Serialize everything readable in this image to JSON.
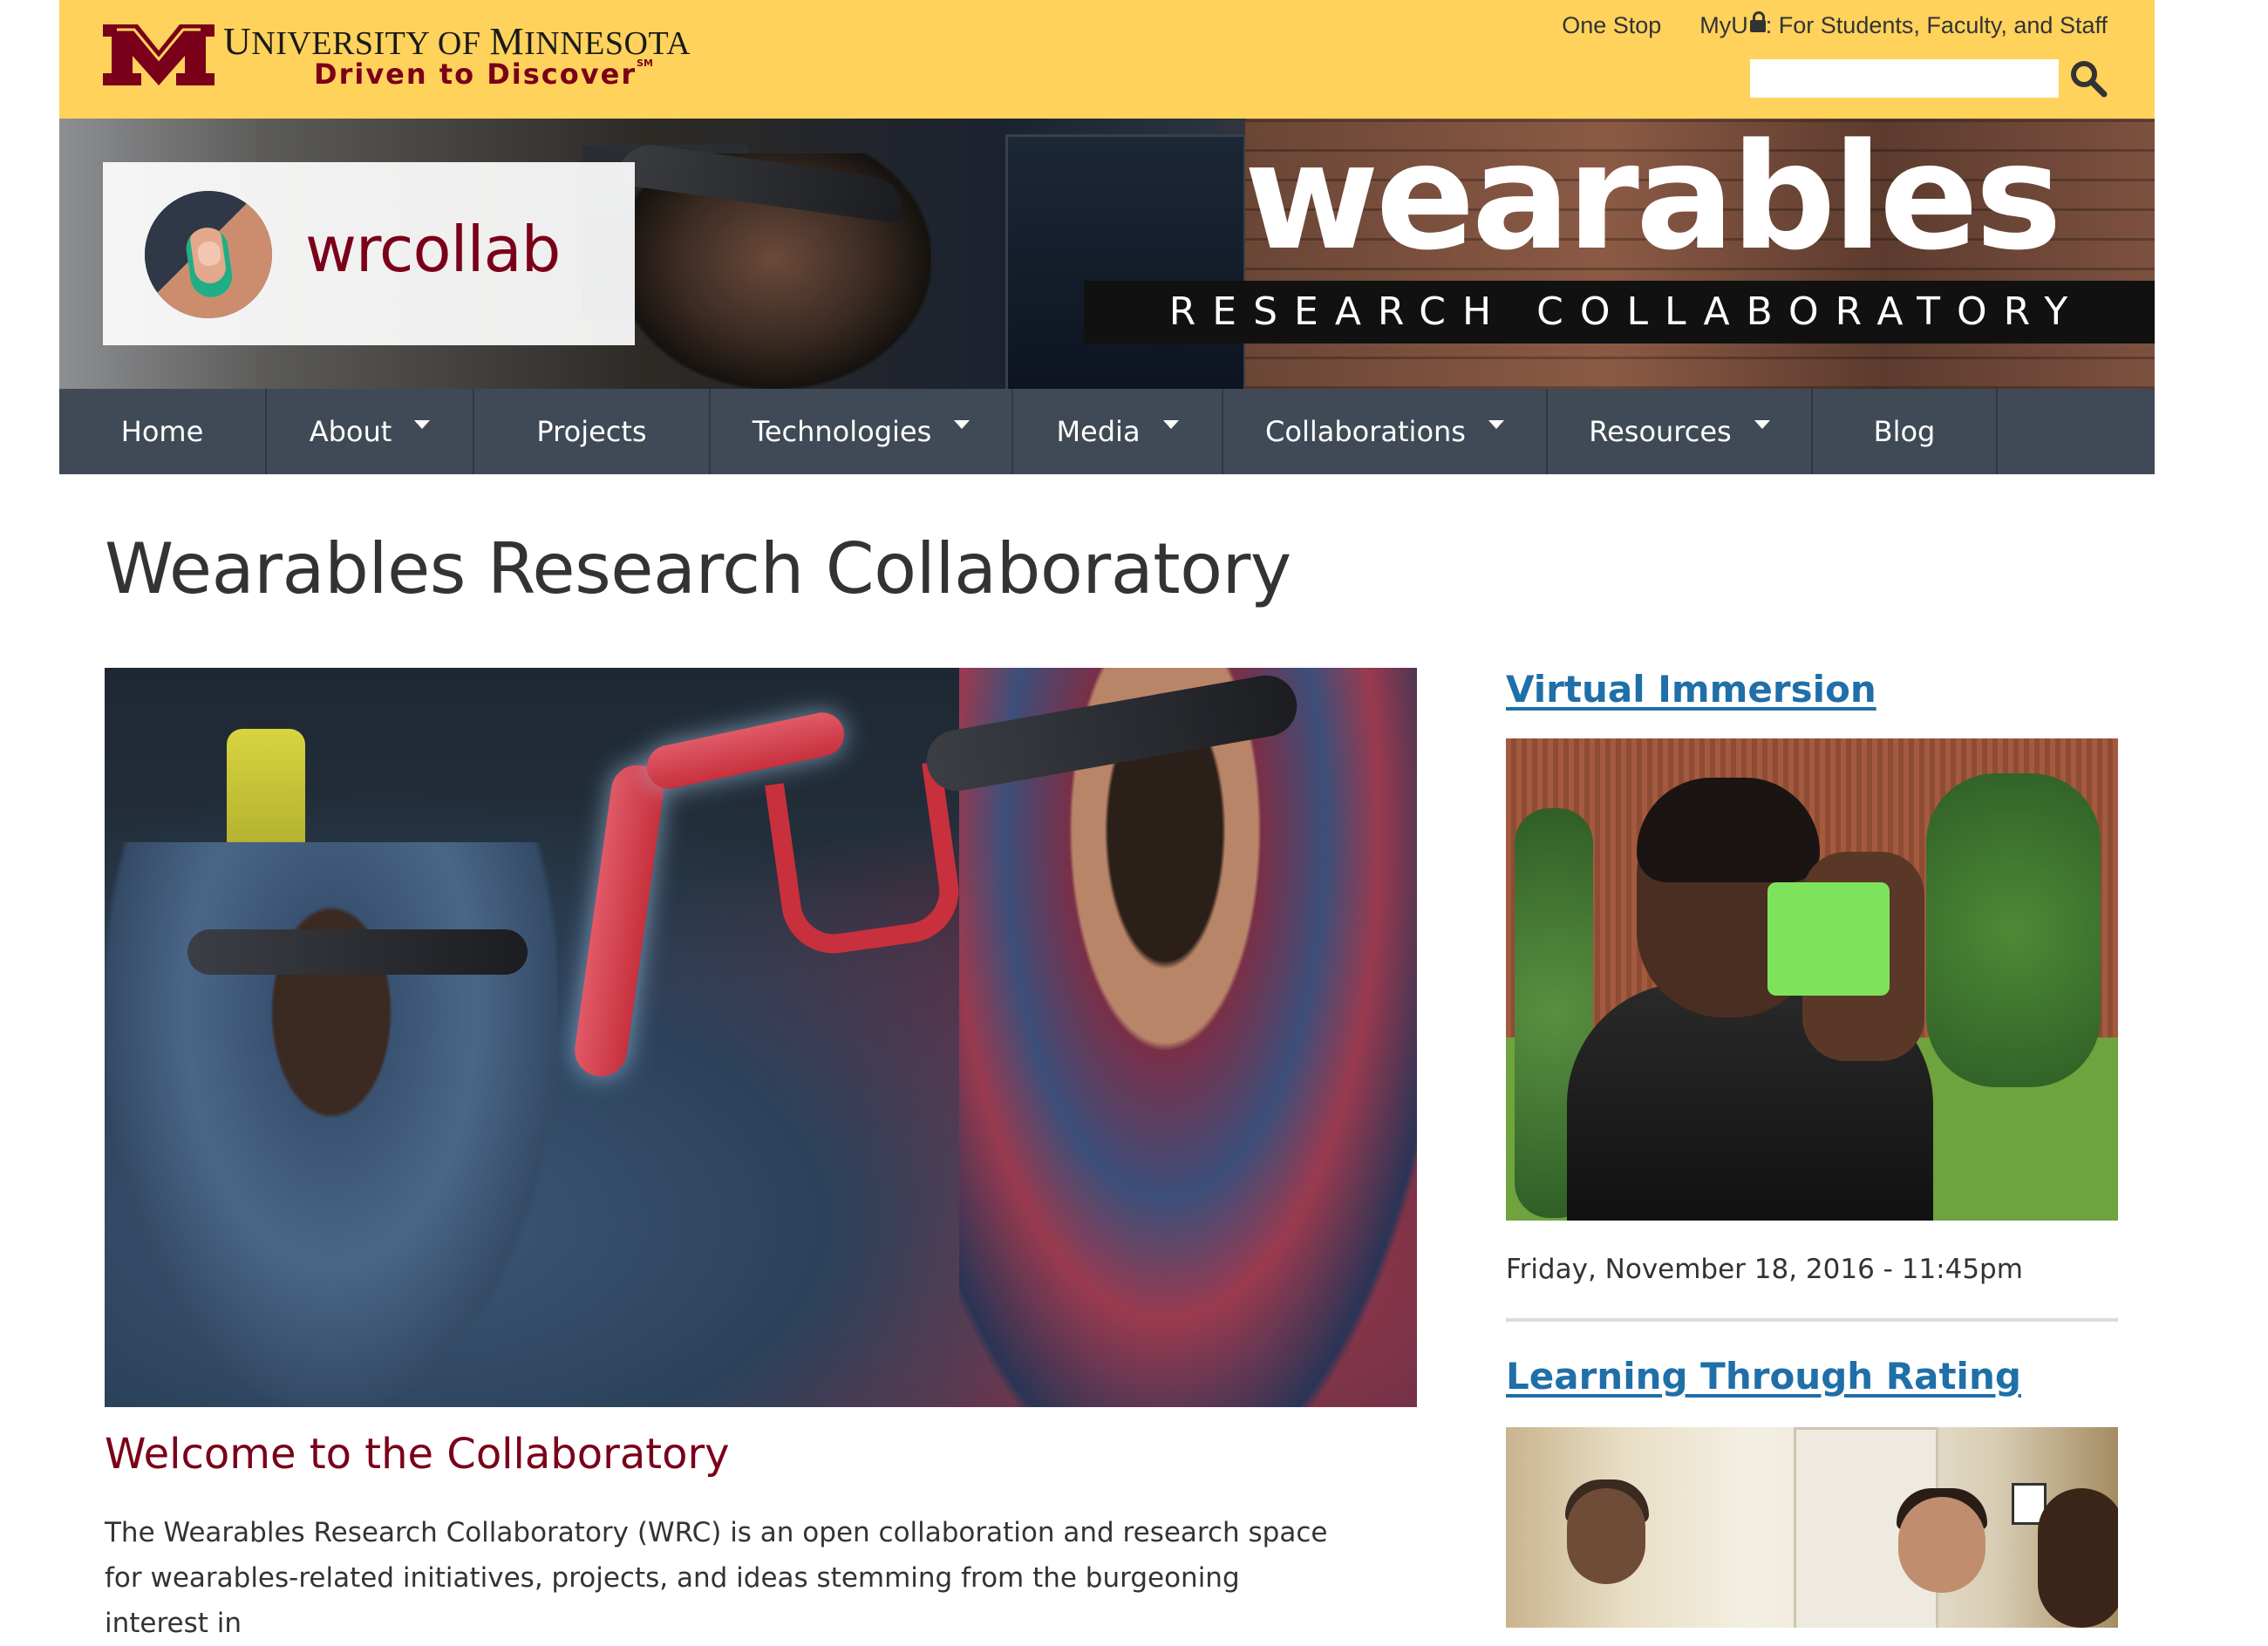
{
  "umn": {
    "name_first_cap": "U",
    "name_first_rest": "NIVERSITY OF ",
    "name_second_cap": "M",
    "name_second_rest": "INNESOTA",
    "tagline": "Driven to Discover",
    "tagline_mark": "SM",
    "links": {
      "one_stop": "One Stop",
      "myu": "MyU",
      "myu_desc": ": For Students, Faculty, and Staff"
    },
    "search_value": ""
  },
  "banner": {
    "brand_name": "wrcollab",
    "title": "wearables",
    "subtitle": "RESEARCH COLLABORATORY"
  },
  "nav": [
    {
      "label": "Home",
      "has_dropdown": false
    },
    {
      "label": "About",
      "has_dropdown": true
    },
    {
      "label": "Projects",
      "has_dropdown": false
    },
    {
      "label": "Technologies",
      "has_dropdown": true
    },
    {
      "label": "Media",
      "has_dropdown": true
    },
    {
      "label": "Collaborations",
      "has_dropdown": true
    },
    {
      "label": "Resources",
      "has_dropdown": true
    },
    {
      "label": "Blog",
      "has_dropdown": false
    }
  ],
  "main": {
    "page_title": "Wearables Research Collaboratory",
    "welcome_heading": "Welcome to the Collaboratory",
    "intro_line1": "The Wearables Research Collaboratory (WRC) is an open collaboration and research space",
    "intro_line2": "for wearables-related initiatives, projects, and ideas stemming from the burgeoning interest in"
  },
  "sidebar": {
    "stories": [
      {
        "title": "Virtual Immersion",
        "date": "Friday, November 18, 2016 - 11:45pm"
      },
      {
        "title": "Learning Through Rating"
      }
    ]
  },
  "colors": {
    "umn_gold": "#ffd25c",
    "umn_maroon": "#7a0019",
    "nav_bg": "#404a56",
    "link_blue": "#1f6fa8"
  },
  "icons": {
    "search": "magnifier-icon",
    "lock": "lock-icon",
    "dropdown": "caret-down-icon"
  }
}
